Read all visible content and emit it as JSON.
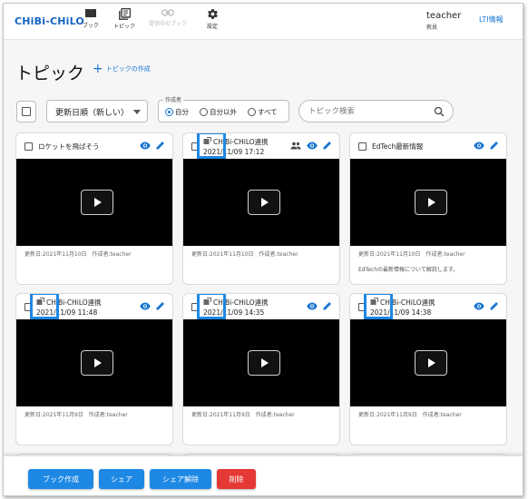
{
  "header": {
    "logo": "CHiBi-CHiLO",
    "nav": [
      {
        "label": "ブック",
        "icon": "book-icon"
      },
      {
        "label": "トピック",
        "icon": "topic-icon"
      },
      {
        "label": "提供中のブック",
        "icon": "link-icon"
      },
      {
        "label": "設定",
        "icon": "gear-icon"
      }
    ],
    "user_name": "teacher",
    "user_role": "教員",
    "lti_link": "LTI情報"
  },
  "page": {
    "title": "トピック",
    "create_link": "トピックの作成"
  },
  "toolbar": {
    "sort_value": "更新日順（新しい）",
    "author_legend": "作成者",
    "author_options": [
      "自分",
      "自分以外",
      "すべて"
    ],
    "author_selected": "自分",
    "search_placeholder": "トピック検索"
  },
  "cards": [
    {
      "title": "ロケットを飛ばそう",
      "meta": "更新日:2021年11月10日　作成者:teacher",
      "desc": ""
    },
    {
      "title_line1": "CHiBi-CHiLO連携",
      "title_line2": "2021/11/09 17:12",
      "meta": "更新日:2021年11月10日　作成者:teacher",
      "desc": ""
    },
    {
      "title": "EdTech最新情報",
      "meta": "更新日:2021年11月10日　作成者:teacher",
      "desc": "EdTechの最新情報について解説します。"
    },
    {
      "title_line1": "CHiBi-CHiLO連携",
      "title_line2": "2021/11/09 11:48",
      "meta": "更新日:2021年11月9日　作成者:teacher",
      "desc": ""
    },
    {
      "title_line1": "CHiBi-CHiLO連携",
      "title_line2": "2021/11/09 14:35",
      "meta": "更新日:2021年11月9日　作成者:teacher",
      "desc": ""
    },
    {
      "title_line1": "CHiBi-CHiLO連携",
      "title_line2": "2021/11/09 14:38",
      "meta": "更新日:2021年11月9日　作成者:teacher",
      "desc": ""
    }
  ],
  "actions": {
    "create_book": "ブック作成",
    "share": "シェア",
    "unshare": "シェア解除",
    "delete": "削除"
  },
  "colors": {
    "primary": "#1976d2",
    "button_blue": "#1e88e5",
    "button_red": "#e53935",
    "highlight": "#1e88e5"
  }
}
